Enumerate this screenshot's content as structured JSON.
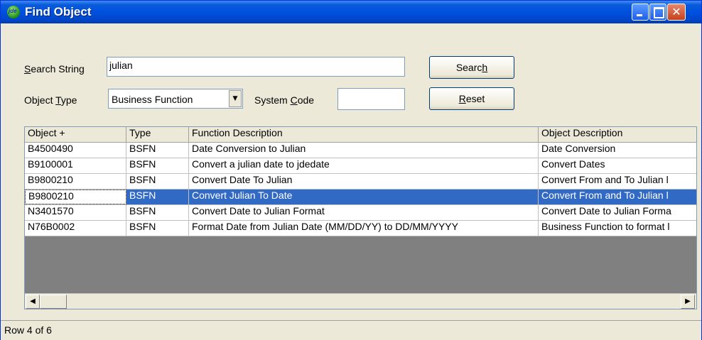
{
  "window": {
    "title": "Find Object"
  },
  "search": {
    "label_prefix": "",
    "label_underlined": "S",
    "label_rest": "earch String",
    "value": "julian"
  },
  "object_type": {
    "label_prefix": "Object ",
    "label_underlined": "T",
    "label_rest": "ype",
    "value": "Business Function"
  },
  "system_code": {
    "label_prefix": "System ",
    "label_underlined": "C",
    "label_rest": "ode",
    "value": ""
  },
  "buttons": {
    "search": {
      "prefix": "Searc",
      "underlined": "h",
      "rest": ""
    },
    "reset": {
      "prefix": "",
      "underlined": "R",
      "rest": "eset"
    }
  },
  "grid": {
    "columns": [
      "Object +",
      "Type",
      "Function Description",
      "Object Description"
    ],
    "rows": [
      [
        "B4500490",
        "BSFN",
        "Date Conversion to Julian",
        "Date Conversion"
      ],
      [
        "B9100001",
        "BSFN",
        "Convert a julian date to jdedate",
        "Convert Dates"
      ],
      [
        "B9800210",
        "BSFN",
        "Convert Date To Julian",
        "Convert From and To Julian l"
      ],
      [
        "B9800210",
        "BSFN",
        "Convert Julian To Date",
        "Convert From and To Julian l"
      ],
      [
        "N3401570",
        "BSFN",
        "Convert Date to Julian Format",
        "Convert Date to Julian Forma"
      ],
      [
        "N76B0002",
        "BSFN",
        "Format Date from Julian Date (MM/DD/YY) to DD/MM/YYYY",
        "Business Function to format l"
      ]
    ],
    "selected_row_index": 3
  },
  "status": {
    "text": "Row 4 of 6"
  },
  "icons": {
    "app": "app-globe-icon",
    "scroll_left": "scroll-left-arrow-icon",
    "scroll_right": "scroll-right-arrow-icon",
    "dropdown": "dropdown-arrow-icon"
  },
  "colors": {
    "titlebar": "#0050e0",
    "selection": "#316ac5",
    "face": "#ece9d8"
  }
}
